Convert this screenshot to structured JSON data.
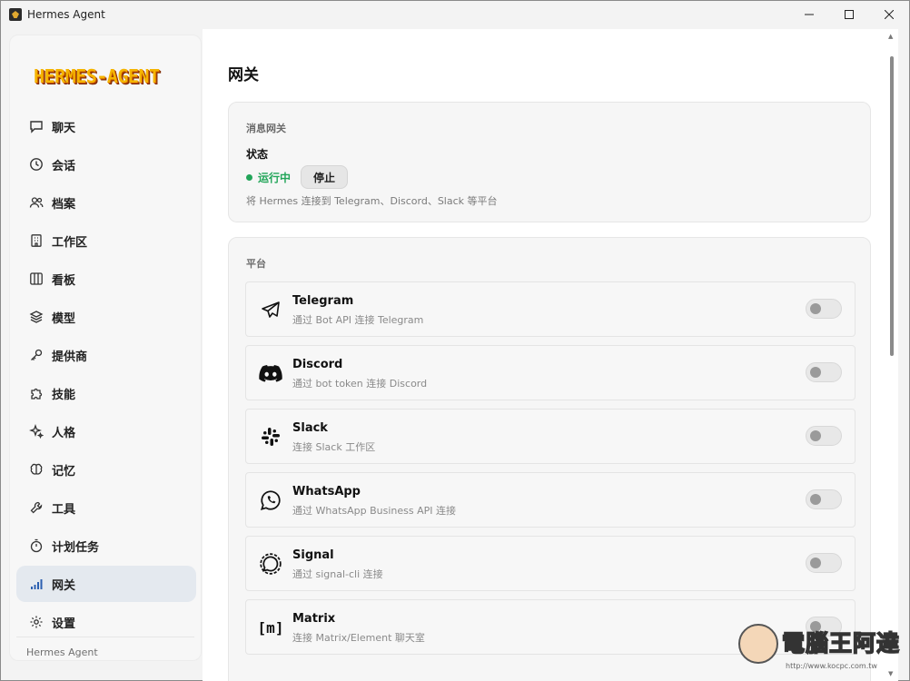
{
  "window": {
    "title": "Hermes Agent"
  },
  "sidebar": {
    "logo": "HERMES-AGENT",
    "items": [
      {
        "label": "聊天",
        "icon": "chat-icon",
        "active": false
      },
      {
        "label": "会话",
        "icon": "clock-icon",
        "active": false
      },
      {
        "label": "档案",
        "icon": "users-icon",
        "active": false
      },
      {
        "label": "工作区",
        "icon": "building-icon",
        "active": false
      },
      {
        "label": "看板",
        "icon": "board-icon",
        "active": false
      },
      {
        "label": "模型",
        "icon": "layers-icon",
        "active": false
      },
      {
        "label": "提供商",
        "icon": "key-icon",
        "active": false
      },
      {
        "label": "技能",
        "icon": "puzzle-icon",
        "active": false
      },
      {
        "label": "人格",
        "icon": "sparkles-icon",
        "active": false
      },
      {
        "label": "记忆",
        "icon": "brain-icon",
        "active": false
      },
      {
        "label": "工具",
        "icon": "wrench-icon",
        "active": false
      },
      {
        "label": "计划任务",
        "icon": "timer-icon",
        "active": false
      },
      {
        "label": "网关",
        "icon": "signal-icon",
        "active": true
      },
      {
        "label": "设置",
        "icon": "gear-icon",
        "active": false
      }
    ],
    "footer": "Hermes Agent"
  },
  "main": {
    "title": "网关",
    "gateway": {
      "section": "消息网关",
      "status_label": "状态",
      "status_value": "运行中",
      "status_color": "#22a559",
      "stop_button": "停止",
      "description": "将 Hermes 连接到 Telegram、Discord、Slack 等平台"
    },
    "platforms": {
      "section": "平台",
      "items": [
        {
          "name": "Telegram",
          "desc": "通过 Bot API 连接 Telegram",
          "icon": "telegram-icon",
          "enabled": false
        },
        {
          "name": "Discord",
          "desc": "通过 bot token 连接 Discord",
          "icon": "discord-icon",
          "enabled": false
        },
        {
          "name": "Slack",
          "desc": "连接 Slack 工作区",
          "icon": "slack-icon",
          "enabled": false
        },
        {
          "name": "WhatsApp",
          "desc": "通过 WhatsApp Business API 连接",
          "icon": "whatsapp-icon",
          "enabled": false
        },
        {
          "name": "Signal",
          "desc": "通过 signal-cli 连接",
          "icon": "signal-app-icon",
          "enabled": false
        },
        {
          "name": "Matrix",
          "desc": "连接 Matrix/Element 聊天室",
          "icon": "matrix-icon",
          "enabled": false
        }
      ]
    }
  },
  "watermark": {
    "text": "電腦王阿達",
    "url": "http://www.kocpc.com.tw"
  }
}
